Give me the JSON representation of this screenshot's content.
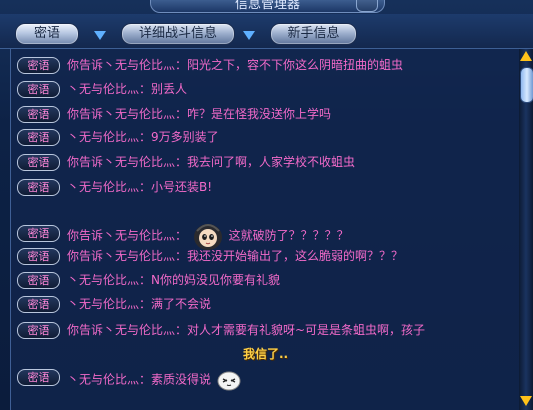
{
  "window": {
    "title": "信息管理器"
  },
  "tabs": [
    {
      "label": "密语"
    },
    {
      "label": "详细战斗信息"
    },
    {
      "label": "新手信息"
    }
  ],
  "badge_label": "密语",
  "messages": [
    {
      "text": "你告诉丶无与伦比灬：阳光之下，容不下你这么阴暗扭曲的蛆虫"
    },
    {
      "text": "丶无与伦比灬：别丢人"
    },
    {
      "text": "你告诉丶无与伦比灬：咋？是在怪我没送你上学吗"
    },
    {
      "text": "丶无与伦比灬：9万多别装了"
    },
    {
      "text": "你告诉丶无与伦比灬：我去问了啊，人家学校不收蛆虫"
    },
    {
      "text": "丶无与伦比灬：小号还装B!"
    },
    {
      "prefix": "你告诉丶无与伦比灬：",
      "suffix": "这就破防了？？？？？"
    },
    {
      "text": "你告诉丶无与伦比灬：我还没开始输出了，这么脆弱的啊？？？"
    },
    {
      "text": "丶无与伦比灬：N你的妈没见你要有礼貌"
    },
    {
      "text": "丶无与伦比灬：满了不会说"
    },
    {
      "text": "你告诉丶无与伦比灬：对人才需要有礼貌呀~可是是条蛆虫啊，孩子"
    },
    {
      "text": "丶无与伦比灬：素质没得说"
    }
  ],
  "emote_caption": "我信了..",
  "icons": {
    "dropdown": "triangle-down-icon",
    "emote1": "hooded-face-emoticon",
    "emote2": "white-blob-emoticon",
    "scroll_up": "arrow-up-icon",
    "scroll_down": "arrow-down-icon"
  },
  "colors": {
    "message_text": "#f26ac9",
    "badge_text": "#ff88d8",
    "emote_caption": "#ffd046",
    "scroll_arrows": "#ffc21a"
  }
}
